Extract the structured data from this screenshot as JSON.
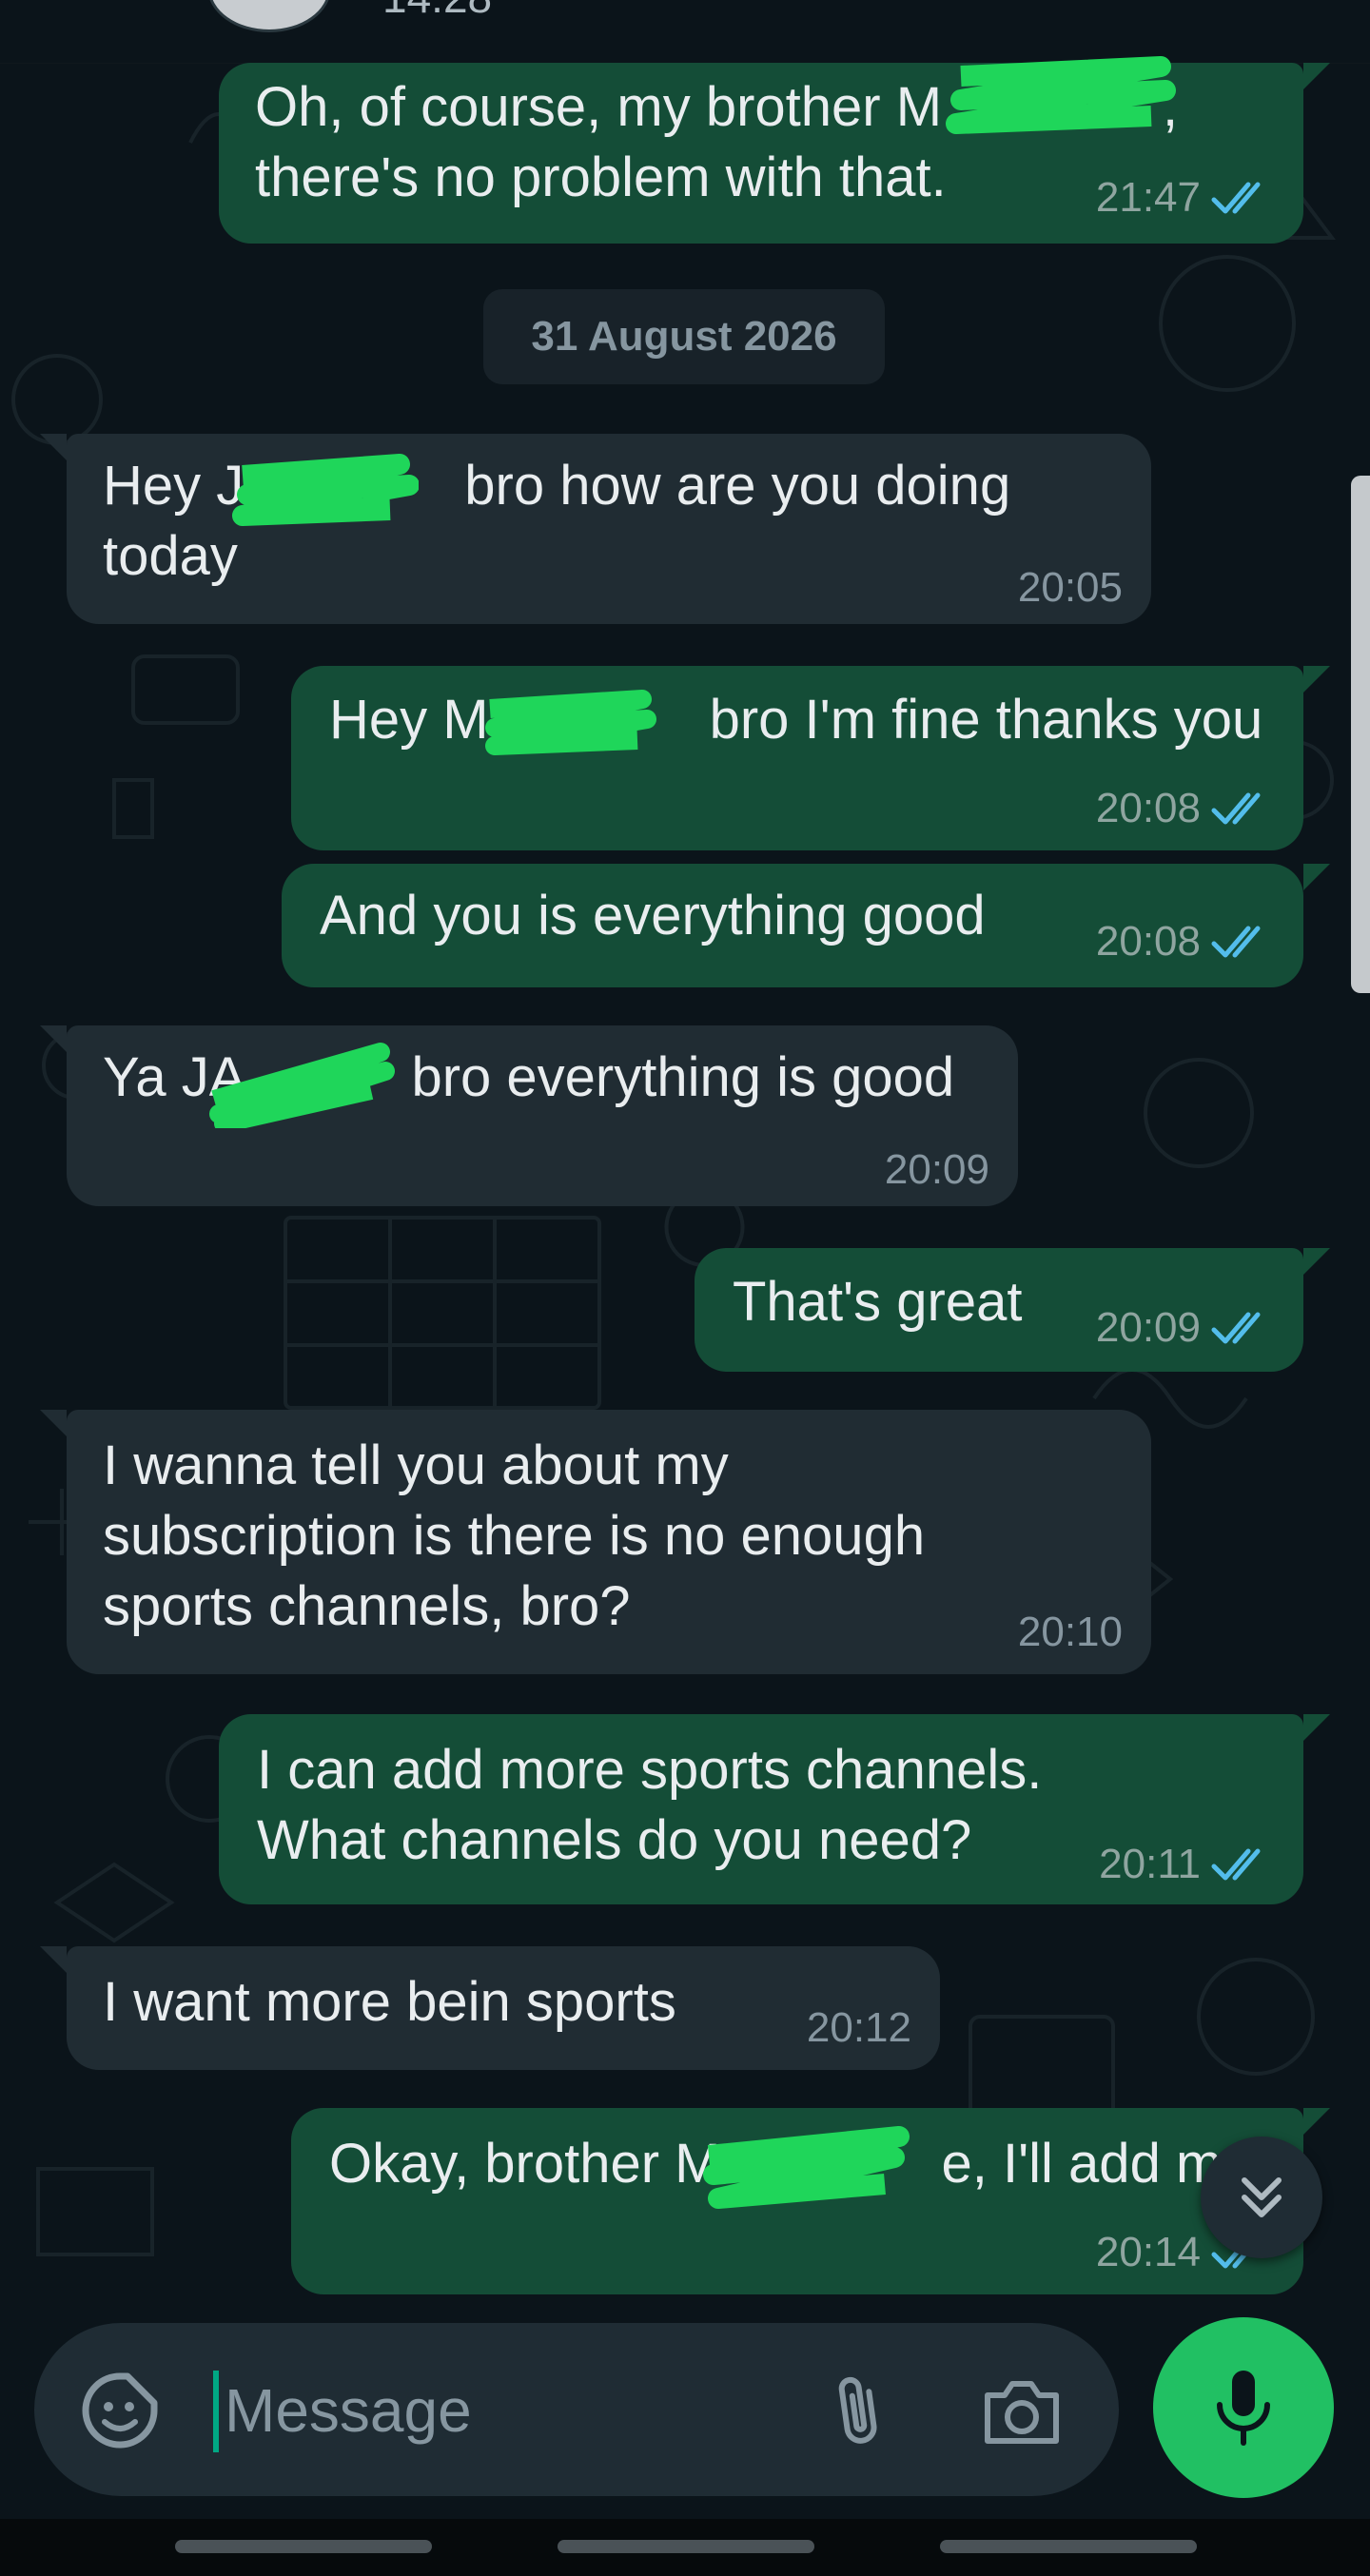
{
  "header": {
    "time": "14:28"
  },
  "date_chip": "31 August 2026",
  "messages": [
    {
      "dir": "out",
      "text": "Oh, of course, my brother M    ,\nthere's no problem with that.",
      "time": "21:47",
      "status": "read"
    },
    {
      "dir": "in",
      "text": "Hey J    bro how are you doing\ntoday",
      "time": "20:05"
    },
    {
      "dir": "out",
      "text": "Hey M    bro I'm fine thanks you",
      "time": "20:08",
      "status": "read"
    },
    {
      "dir": "out",
      "text": "And you is everything good",
      "time": "20:08",
      "status": "read"
    },
    {
      "dir": "in",
      "text": "Ya JA   bro everything is good",
      "time": "20:09"
    },
    {
      "dir": "out",
      "text": "That's great",
      "time": "20:09",
      "status": "read"
    },
    {
      "dir": "in",
      "text": "I wanna tell you about my\nsubscription is there is no enough\nsports channels, bro?",
      "time": "20:10"
    },
    {
      "dir": "out",
      "text": "I can add more sports channels.\nWhat channels do you need?",
      "time": "20:11",
      "status": "read"
    },
    {
      "dir": "in",
      "text": "I want more bein sports",
      "time": "20:12"
    },
    {
      "dir": "out",
      "text": "Okay, brother M    e, I'll add mor",
      "time": "20:14",
      "status": "read"
    }
  ],
  "composer": {
    "placeholder": "Message"
  },
  "colors": {
    "background": "#0b141a",
    "outgoing_bubble": "#144d37",
    "incoming_bubble": "#202c33",
    "read_ticks": "#53bdeb",
    "accent_green": "#21c063",
    "redaction": "#1fd65a"
  },
  "icons": [
    "sticker-icon",
    "paperclip-icon",
    "camera-icon",
    "microphone-icon",
    "double-chevron-down-icon",
    "double-check-icon"
  ]
}
